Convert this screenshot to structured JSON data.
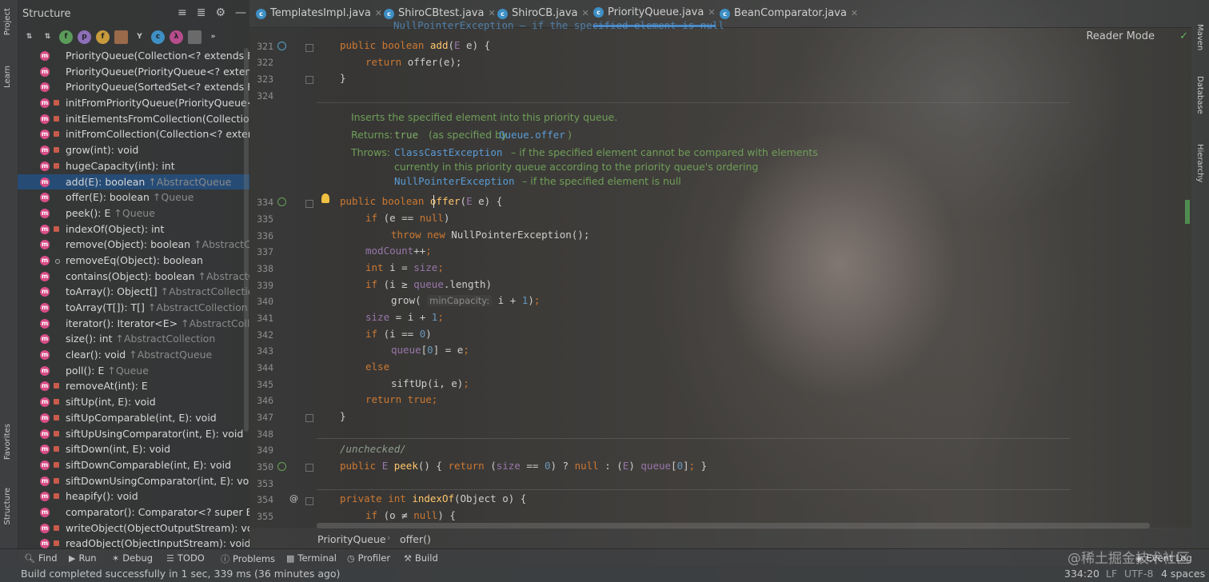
{
  "left_strip": {
    "project": "Project",
    "learn": "Learn",
    "favorites": "Favorites",
    "structure": "Structure"
  },
  "right_strip": {
    "maven": "Maven",
    "database": "Database",
    "hierarchy": "Hierarchy"
  },
  "structure": {
    "title": "Structure",
    "items": [
      {
        "sig": "PriorityQueue(Collection<? extends E>)",
        "parent": "",
        "vis": "public"
      },
      {
        "sig": "PriorityQueue(PriorityQueue<? extends",
        "parent": "",
        "vis": "public"
      },
      {
        "sig": "PriorityQueue(SortedSet<? extends E>)",
        "parent": "",
        "vis": "public"
      },
      {
        "sig": "initFromPriorityQueue(PriorityQueue<?",
        "parent": "",
        "vis": "private"
      },
      {
        "sig": "initElementsFromCollection(Collection<",
        "parent": "",
        "vis": "private"
      },
      {
        "sig": "initFromCollection(Collection<? extends",
        "parent": "",
        "vis": "private"
      },
      {
        "sig": "grow(int): void",
        "parent": "",
        "vis": "private"
      },
      {
        "sig": "hugeCapacity(int): int",
        "parent": "",
        "vis": "private"
      },
      {
        "sig": "add(E): boolean",
        "parent": "↑AbstractQueue",
        "vis": "public"
      },
      {
        "sig": "offer(E): boolean",
        "parent": "↑Queue",
        "vis": "public"
      },
      {
        "sig": "peek(): E",
        "parent": "↑Queue",
        "vis": "public"
      },
      {
        "sig": "indexOf(Object): int",
        "parent": "",
        "vis": "private"
      },
      {
        "sig": "remove(Object): boolean",
        "parent": "↑AbstractColle",
        "vis": "public"
      },
      {
        "sig": "removeEq(Object): boolean",
        "parent": "",
        "vis": "package"
      },
      {
        "sig": "contains(Object): boolean",
        "parent": "↑AbstractColl",
        "vis": "public"
      },
      {
        "sig": "toArray(): Object[]",
        "parent": "↑AbstractCollection",
        "vis": "public"
      },
      {
        "sig": "toArray(T[]): T[]",
        "parent": "↑AbstractCollection",
        "vis": "public"
      },
      {
        "sig": "iterator(): Iterator<E>",
        "parent": "↑AbstractCollectio",
        "vis": "public"
      },
      {
        "sig": "size(): int",
        "parent": "↑AbstractCollection",
        "vis": "public"
      },
      {
        "sig": "clear(): void",
        "parent": "↑AbstractQueue",
        "vis": "public"
      },
      {
        "sig": "poll(): E",
        "parent": "↑Queue",
        "vis": "public"
      },
      {
        "sig": "removeAt(int): E",
        "parent": "",
        "vis": "private"
      },
      {
        "sig": "siftUp(int, E): void",
        "parent": "",
        "vis": "private"
      },
      {
        "sig": "siftUpComparable(int, E): void",
        "parent": "",
        "vis": "private"
      },
      {
        "sig": "siftUpUsingComparator(int, E): void",
        "parent": "",
        "vis": "private"
      },
      {
        "sig": "siftDown(int, E): void",
        "parent": "",
        "vis": "private"
      },
      {
        "sig": "siftDownComparable(int, E): void",
        "parent": "",
        "vis": "private"
      },
      {
        "sig": "siftDownUsingComparator(int, E): void",
        "parent": "",
        "vis": "private"
      },
      {
        "sig": "heapify(): void",
        "parent": "",
        "vis": "private"
      },
      {
        "sig": "comparator(): Comparator<? super E>",
        "parent": "",
        "vis": "public"
      },
      {
        "sig": "writeObject(ObjectOutputStream): void",
        "parent": "",
        "vis": "private"
      },
      {
        "sig": "readObject(ObjectInputStream): void",
        "parent": "",
        "vis": "private"
      }
    ],
    "selected_index": 8
  },
  "tabs": [
    {
      "label": "TemplatesImpl.java"
    },
    {
      "label": "ShiroCBtest.java"
    },
    {
      "label": "ShiroCB.java"
    },
    {
      "label": "PriorityQueue.java"
    },
    {
      "label": "BeanComparator.java"
    }
  ],
  "active_tab": 3,
  "reader_mode": "Reader Mode",
  "editor": {
    "top_partial": "NullPointerException – if the specified element is null",
    "line_numbers": {
      "l321": "321",
      "l322": "322",
      "l323": "323",
      "l324": "324",
      "l334": "334",
      "l335": "335",
      "l336": "336",
      "l337": "337",
      "l338": "338",
      "l339": "339",
      "l340": "340",
      "l341": "341",
      "l342": "342",
      "l343": "343",
      "l344": "344",
      "l345": "345",
      "l346": "346",
      "l347": "347",
      "l348": "348",
      "l349": "349",
      "l350": "350",
      "l353": "353",
      "l354": "354",
      "l355": "355"
    },
    "doc": {
      "summary": "Inserts the specified element into this priority queue.",
      "returns_label": "Returns:",
      "returns_code": "true",
      "returns_text": "(as specified by",
      "returns_link": "Queue.offer",
      "returns_end": ")",
      "throws_label": "Throws:",
      "throws_code1": "ClassCastException",
      "throws_text1": "– if the specified element cannot be compared with elements",
      "throws_text2": "currently in this priority queue according to the priority queue's ordering",
      "throws_code2": "NullPointerException",
      "throws_text3": "– if the specified element is null"
    },
    "inlay_hint": "minCapacity:",
    "comment_unchecked": "/unchecked/"
  },
  "breadcrumb": {
    "class": "PriorityQueue",
    "method": "offer()"
  },
  "tool_windows": [
    {
      "icon": "search-icon",
      "label": "Find"
    },
    {
      "icon": "run-icon",
      "label": "Run"
    },
    {
      "icon": "debug-icon",
      "label": "Debug"
    },
    {
      "icon": "todo-icon",
      "label": "TODO"
    },
    {
      "icon": "problems-icon",
      "label": "Problems"
    },
    {
      "icon": "terminal-icon",
      "label": "Terminal"
    },
    {
      "icon": "profiler-icon",
      "label": "Profiler"
    },
    {
      "icon": "build-icon",
      "label": "Build"
    }
  ],
  "event_log": "Event Log",
  "status": {
    "message": "Build completed successfully in 1 sec, 339 ms (36 minutes ago)",
    "position": "334:20",
    "line_sep": "LF",
    "encoding": "UTF-8",
    "indent": "4 spaces"
  },
  "watermark": "@稀土掘金技术社区",
  "colors": {
    "keyword": "#cc7832",
    "function": "#ffc66d",
    "field": "#9876aa",
    "number": "#6897bb",
    "doc": "#6f9f58",
    "selection": "#22548c"
  }
}
